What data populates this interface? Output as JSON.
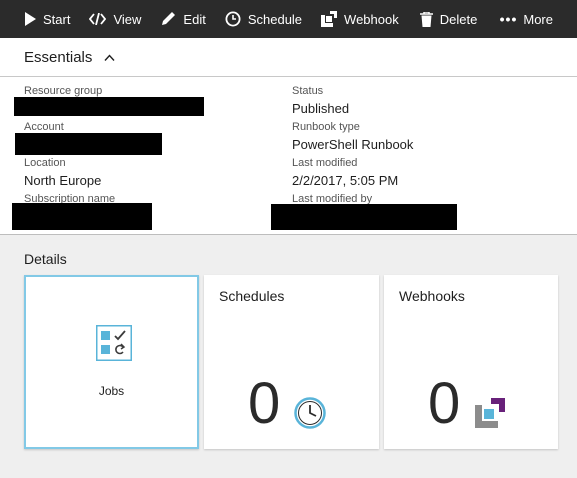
{
  "toolbar": {
    "start": "Start",
    "view": "View",
    "edit": "Edit",
    "schedule": "Schedule",
    "webhook": "Webhook",
    "delete": "Delete",
    "more": "More"
  },
  "essentials": {
    "title": "Essentials",
    "left": [
      {
        "label": "Resource group",
        "value": ""
      },
      {
        "label": "Account",
        "value": ""
      },
      {
        "label": "Location",
        "value": "North Europe"
      },
      {
        "label": "Subscription name",
        "value": ""
      }
    ],
    "right": [
      {
        "label": "Status",
        "value": "Published"
      },
      {
        "label": "Runbook type",
        "value": "PowerShell Runbook"
      },
      {
        "label": "Last modified",
        "value": "2/2/2017, 5:05 PM"
      },
      {
        "label": "Last modified by",
        "value": ""
      }
    ]
  },
  "details": {
    "title": "Details",
    "tiles": [
      {
        "title": "",
        "label": "Jobs",
        "icon": "jobs-icon"
      },
      {
        "title": "Schedules",
        "count": "0",
        "icon": "clock-icon"
      },
      {
        "title": "Webhooks",
        "count": "0",
        "icon": "webhook-icon"
      }
    ]
  },
  "colors": {
    "toolbar_bg": "#2b2b2b",
    "accent": "#59b4d9",
    "selected_border": "#82c9e6",
    "webhook_purple": "#68217a",
    "details_bg": "#efefef"
  }
}
